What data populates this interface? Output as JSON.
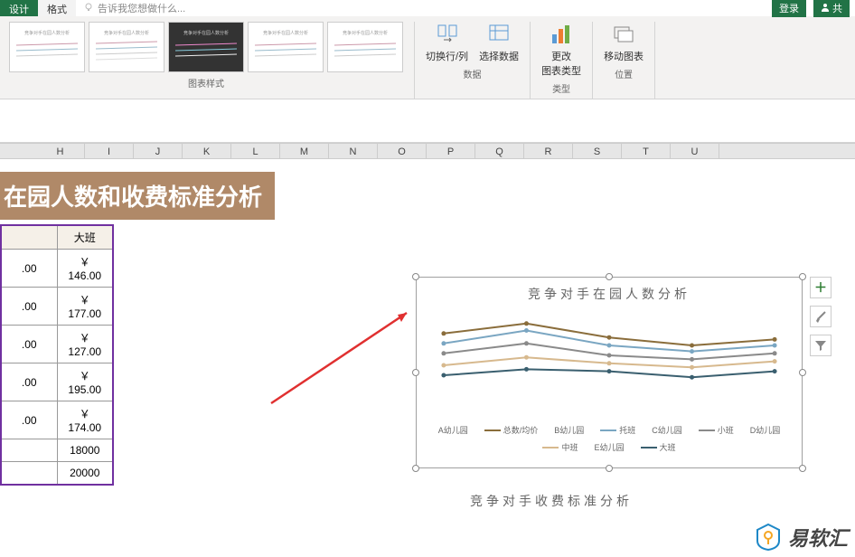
{
  "tabs": {
    "design": "设计",
    "format": "格式"
  },
  "tell_me": "告诉我您想做什么...",
  "login": "登录",
  "share": "共",
  "ribbon": {
    "chart_styles_label": "图表样式",
    "switch_rc": "切换行/列",
    "select_data": "选择数据",
    "data_label": "数据",
    "change_type": "更改\n图表类型",
    "type_label": "类型",
    "move_chart": "移动图表",
    "location_label": "位置"
  },
  "col_headers": [
    "H",
    "I",
    "J",
    "K",
    "L",
    "M",
    "N",
    "O",
    "P",
    "Q",
    "R",
    "S",
    "T",
    "U"
  ],
  "banner_title": "在园人数和收费标准分析",
  "table": {
    "headers": [
      "",
      "大班"
    ],
    "rows": [
      [
        ".00",
        "￥ 146.00"
      ],
      [
        ".00",
        "￥ 177.00"
      ],
      [
        ".00",
        "￥ 127.00"
      ],
      [
        ".00",
        "￥ 195.00"
      ],
      [
        ".00",
        "￥ 174.00"
      ],
      [
        "",
        "18000"
      ],
      [
        "",
        "20000"
      ]
    ]
  },
  "chart_data": {
    "type": "line",
    "title": "竞争对手在园人数分析",
    "categories": [
      "A幼儿园",
      "B幼儿园",
      "C幼儿园",
      "D幼儿园",
      "E幼儿园"
    ],
    "series": [
      {
        "name": "总数/均价",
        "color": "#8a6d3b",
        "values": [
          82,
          92,
          78,
          70,
          76
        ]
      },
      {
        "name": "托班",
        "color": "#7aa6c2",
        "values": [
          72,
          85,
          70,
          64,
          70
        ]
      },
      {
        "name": "小班",
        "color": "#8a8a8a",
        "values": [
          62,
          72,
          60,
          56,
          62
        ]
      },
      {
        "name": "中班",
        "color": "#d7b98e",
        "values": [
          50,
          58,
          52,
          48,
          54
        ]
      },
      {
        "name": "大班",
        "color": "#3a5f6f",
        "values": [
          40,
          46,
          44,
          38,
          44
        ]
      }
    ],
    "ylim": [
      0,
      100
    ]
  },
  "chart2_title": "竞争对手收费标准分析",
  "side_tools": {
    "plus": "+",
    "brush": "brush",
    "filter": "filter"
  },
  "watermark": "易软汇"
}
